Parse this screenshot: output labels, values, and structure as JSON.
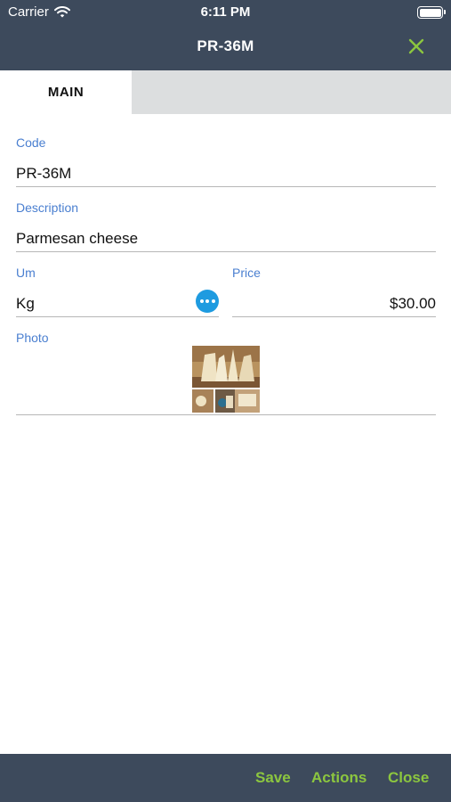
{
  "status_bar": {
    "carrier": "Carrier",
    "time": "6:11 PM"
  },
  "nav": {
    "title": "PR-36M",
    "close_icon": "close-x-icon",
    "accent_color": "#8cc63f"
  },
  "tabs": [
    {
      "label": "MAIN",
      "active": true
    }
  ],
  "form": {
    "code": {
      "label": "Code",
      "value": "PR-36M"
    },
    "description": {
      "label": "Description",
      "value": "Parmesan cheese"
    },
    "um": {
      "label": "Um",
      "value": "Kg",
      "lookup_icon": "ellipsis-icon"
    },
    "price": {
      "label": "Price",
      "value": "$30.00"
    },
    "photo": {
      "label": "Photo",
      "alt": "Parmesan cheese photo"
    }
  },
  "toolbar": {
    "save_label": "Save",
    "actions_label": "Actions",
    "close_label": "Close"
  },
  "colors": {
    "header_bg": "#3d4a5c",
    "label_blue": "#4a7fd0",
    "lookup_blue": "#1e9be0",
    "tab_bar_bg": "#dcdedf"
  }
}
